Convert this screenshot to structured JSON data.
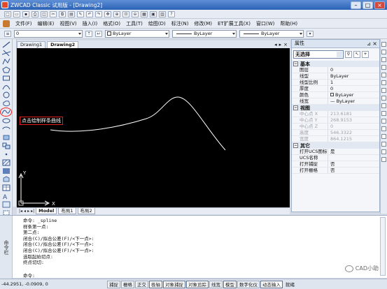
{
  "window": {
    "title": "ZWCAD Classic 试用版 - [Drawing2]"
  },
  "menu": [
    "文件(F)",
    "编辑(E)",
    "视图(V)",
    "插入(I)",
    "格式(O)",
    "工具(T)",
    "绘图(D)",
    "标注(N)",
    "修改(M)",
    "ET扩展工具(X)",
    "窗口(W)",
    "帮助(H)"
  ],
  "layer_bar": {
    "layer": "0",
    "color": "ByLayer",
    "linetype": "ByLayer",
    "lineweight": "ByLayer"
  },
  "doc_tabs": [
    "Drawing1",
    "Drawing2"
  ],
  "annotation": "点击绘制样条曲线",
  "ucs": {
    "x": "X",
    "y": "Y"
  },
  "layout_tabs": [
    "Model",
    "布局1",
    "布局2"
  ],
  "properties": {
    "title": "属性",
    "selection": "无选择",
    "sections": {
      "basic": "基本",
      "view": "视图",
      "misc": "其它"
    },
    "basic_rows": [
      {
        "k": "图层",
        "v": "0"
      },
      {
        "k": "线型",
        "v": "ByLayer"
      },
      {
        "k": "线型比例",
        "v": "1"
      },
      {
        "k": "厚度",
        "v": "0"
      },
      {
        "k": "颜色",
        "v": "ByLayer"
      },
      {
        "k": "线宽",
        "v": "ByLayer"
      }
    ],
    "view_rows": [
      {
        "k": "中心点 X",
        "v": "213.6181"
      },
      {
        "k": "中心点 Y",
        "v": "268.9153"
      },
      {
        "k": "中心点 Z",
        "v": "0"
      },
      {
        "k": "高度",
        "v": "546.3322"
      },
      {
        "k": "宽度",
        "v": "864.1215"
      }
    ],
    "misc_rows": [
      {
        "k": "打开UCS图标",
        "v": "是"
      },
      {
        "k": "UCS名称",
        "v": ""
      },
      {
        "k": "打开捕捉",
        "v": "否"
      },
      {
        "k": "打开栅格",
        "v": "否"
      }
    ]
  },
  "command": {
    "handle": "命令栏",
    "lines": [
      "命令: _spline",
      "样条第一点:",
      "第二点:",
      "闭合(C)/拟合公差(F)/<下一点>:",
      "闭合(C)/拟合公差(F)/<下一点>:",
      "闭合(C)/拟合公差(F)/<下一点>:",
      "选取起始切点:",
      "终点切切:"
    ],
    "prompt": "命令:"
  },
  "watermark": "CAD小助",
  "status": {
    "coords": "-44.2951, -0.0909, 0",
    "buttons": [
      "捕捉",
      "栅格",
      "正交",
      "极轴",
      "对象捕捉",
      "对象追踪",
      "线宽",
      "模型",
      "数字化仪",
      "动态输入",
      "就绪"
    ],
    "on": [
      "极轴",
      "对象捕捉",
      "对象追踪",
      "模型",
      "动态输入"
    ]
  },
  "colors": {
    "canvas": "#000000",
    "spline": "#ffffff",
    "annotation_border": "#e21d1d"
  }
}
